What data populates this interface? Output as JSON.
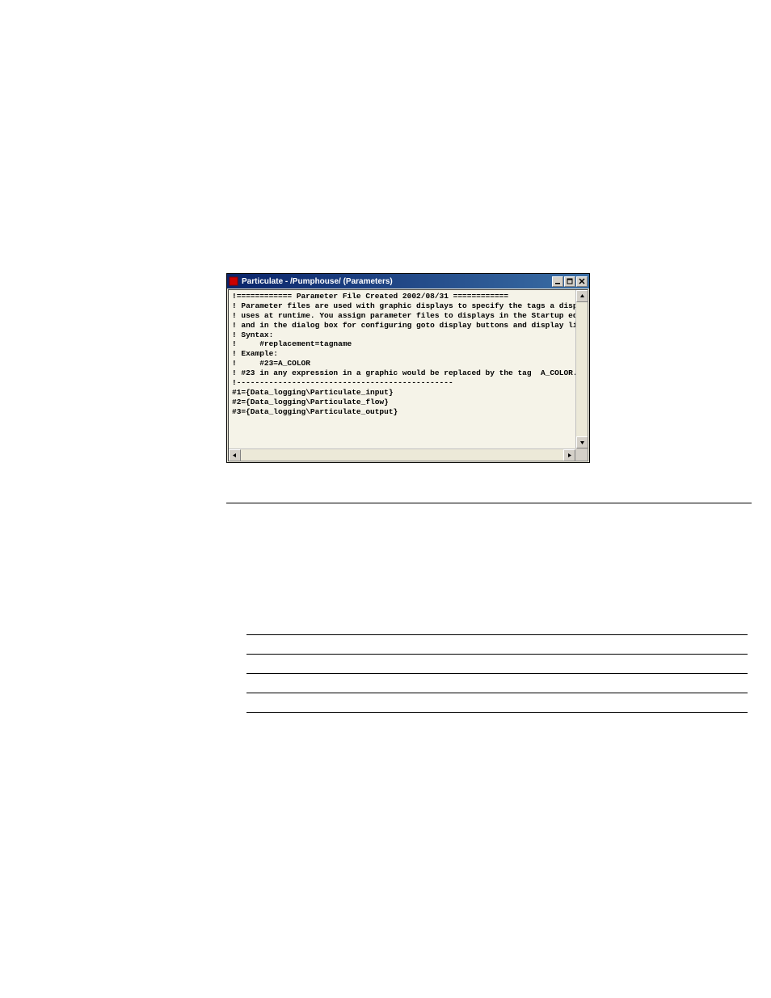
{
  "window": {
    "title": "Particulate - /Pumphouse/ (Parameters)",
    "controls": {
      "minimize": "–",
      "maximize": "□",
      "close": "×"
    }
  },
  "editor": {
    "lines": [
      "!============ Parameter File Created 2002/08/31 ============",
      "! Parameter files are used with graphic displays to specify the tags a display",
      "! uses at runtime. You assign parameter files to displays in the Startup editor",
      "! and in the dialog box for configuring goto display buttons and display list selectors.",
      "! Syntax:",
      "!     #replacement=tagname",
      "! Example:",
      "!     #23=A_COLOR",
      "! #23 in any expression in a graphic would be replaced by the tag  A_COLOR.",
      "!-----------------------------------------------",
      "#1={Data_logging\\Particulate_input}",
      "#2={Data_logging\\Particulate_flow}",
      "#3={Data_logging\\Particulate_output}"
    ]
  },
  "scroll": {
    "up": "▲",
    "down": "▼",
    "left": "◀",
    "right": "▶"
  }
}
